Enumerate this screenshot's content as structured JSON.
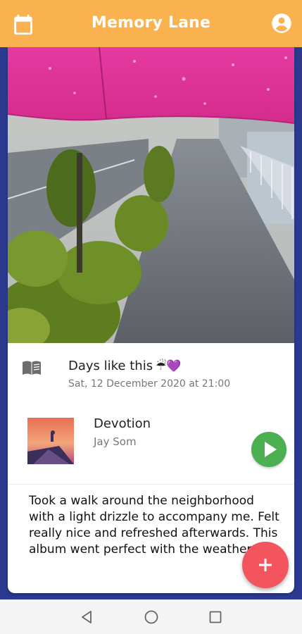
{
  "app": {
    "title": "Memory Lane"
  },
  "entry": {
    "title": "Days like this",
    "title_emoji": "☔💜",
    "date": "Sat, 12 December 2020 at 21:00",
    "note": "Took a walk around the neighborhood with a light drizzle to accompany me. Felt really nice and refreshed afterwards. This album went perfect with the weather too"
  },
  "song": {
    "title": "Devotion",
    "artist": "Jay Som"
  },
  "icons": {
    "appbar_left": "calendar-icon",
    "appbar_right": "account-icon",
    "entry": "book-icon",
    "play": "play-icon",
    "fab": "add-icon",
    "nav": [
      "back-icon",
      "home-icon",
      "recents-icon"
    ]
  },
  "colors": {
    "appbar": "#f9b24f",
    "background": "#2b3a8f",
    "play_button": "#4caf50",
    "fab": "#f2555e"
  }
}
